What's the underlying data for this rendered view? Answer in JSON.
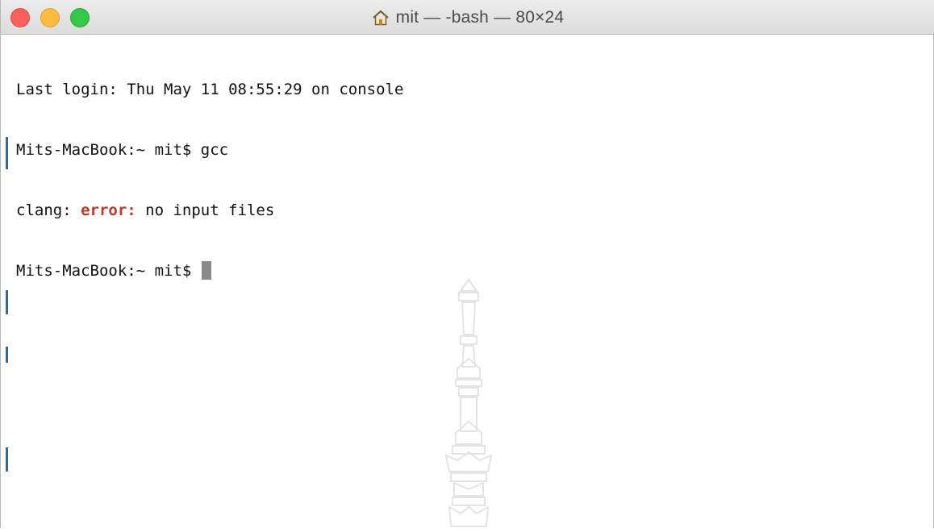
{
  "window": {
    "title": "mit — -bash — 80×24",
    "title_icon": "home-icon",
    "buttons": {
      "close_color": "#fc605c",
      "minimize_color": "#fdbc40",
      "zoom_color": "#34c84a"
    }
  },
  "terminal": {
    "lines": [
      {
        "text": "Last login: Thu May 11 08:55:29 on console"
      },
      {
        "prompt": "Mits-MacBook:~ mit$ ",
        "command": "gcc"
      },
      {
        "prefix": "clang: ",
        "error": "error:",
        "message": " no input files"
      },
      {
        "prompt": "Mits-MacBook:~ mit$ "
      }
    ],
    "error_color": "#c0392b",
    "cursor_color": "#8a8a8a"
  },
  "watermark": {
    "icon": "temple-spire-watermark"
  }
}
